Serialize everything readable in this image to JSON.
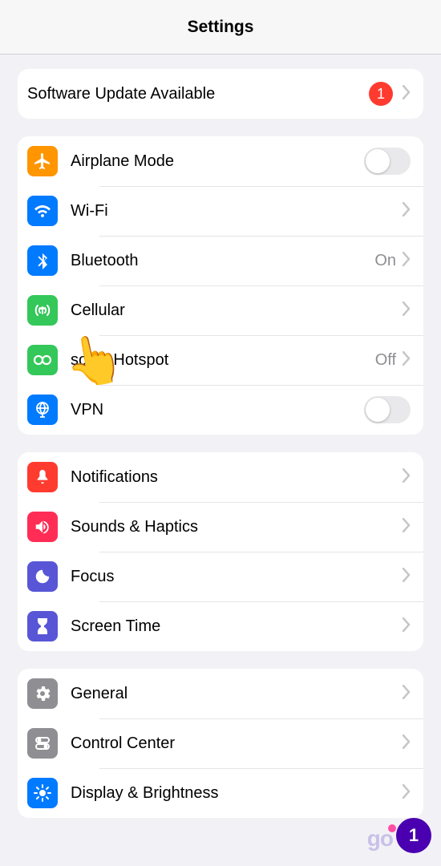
{
  "header": {
    "title": "Settings"
  },
  "update": {
    "label": "Software Update Available",
    "badge": "1"
  },
  "connectivity": {
    "airplane": {
      "label": "Airplane Mode"
    },
    "wifi": {
      "label": "Wi-Fi"
    },
    "bluetooth": {
      "label": "Bluetooth",
      "value": "On"
    },
    "cellular": {
      "label": "Cellular"
    },
    "hotspot": {
      "label": "sonal Hotspot",
      "value": "Off"
    },
    "vpn": {
      "label": "VPN"
    }
  },
  "notifications_group": {
    "notifications": {
      "label": "Notifications"
    },
    "sounds": {
      "label": "Sounds & Haptics"
    },
    "focus": {
      "label": "Focus"
    },
    "screentime": {
      "label": "Screen Time"
    }
  },
  "general_group": {
    "general": {
      "label": "General"
    },
    "control": {
      "label": "Control Center"
    },
    "display": {
      "label": "Display & Brightness"
    }
  },
  "watermark": {
    "text": "go"
  },
  "step": {
    "number": "1"
  }
}
